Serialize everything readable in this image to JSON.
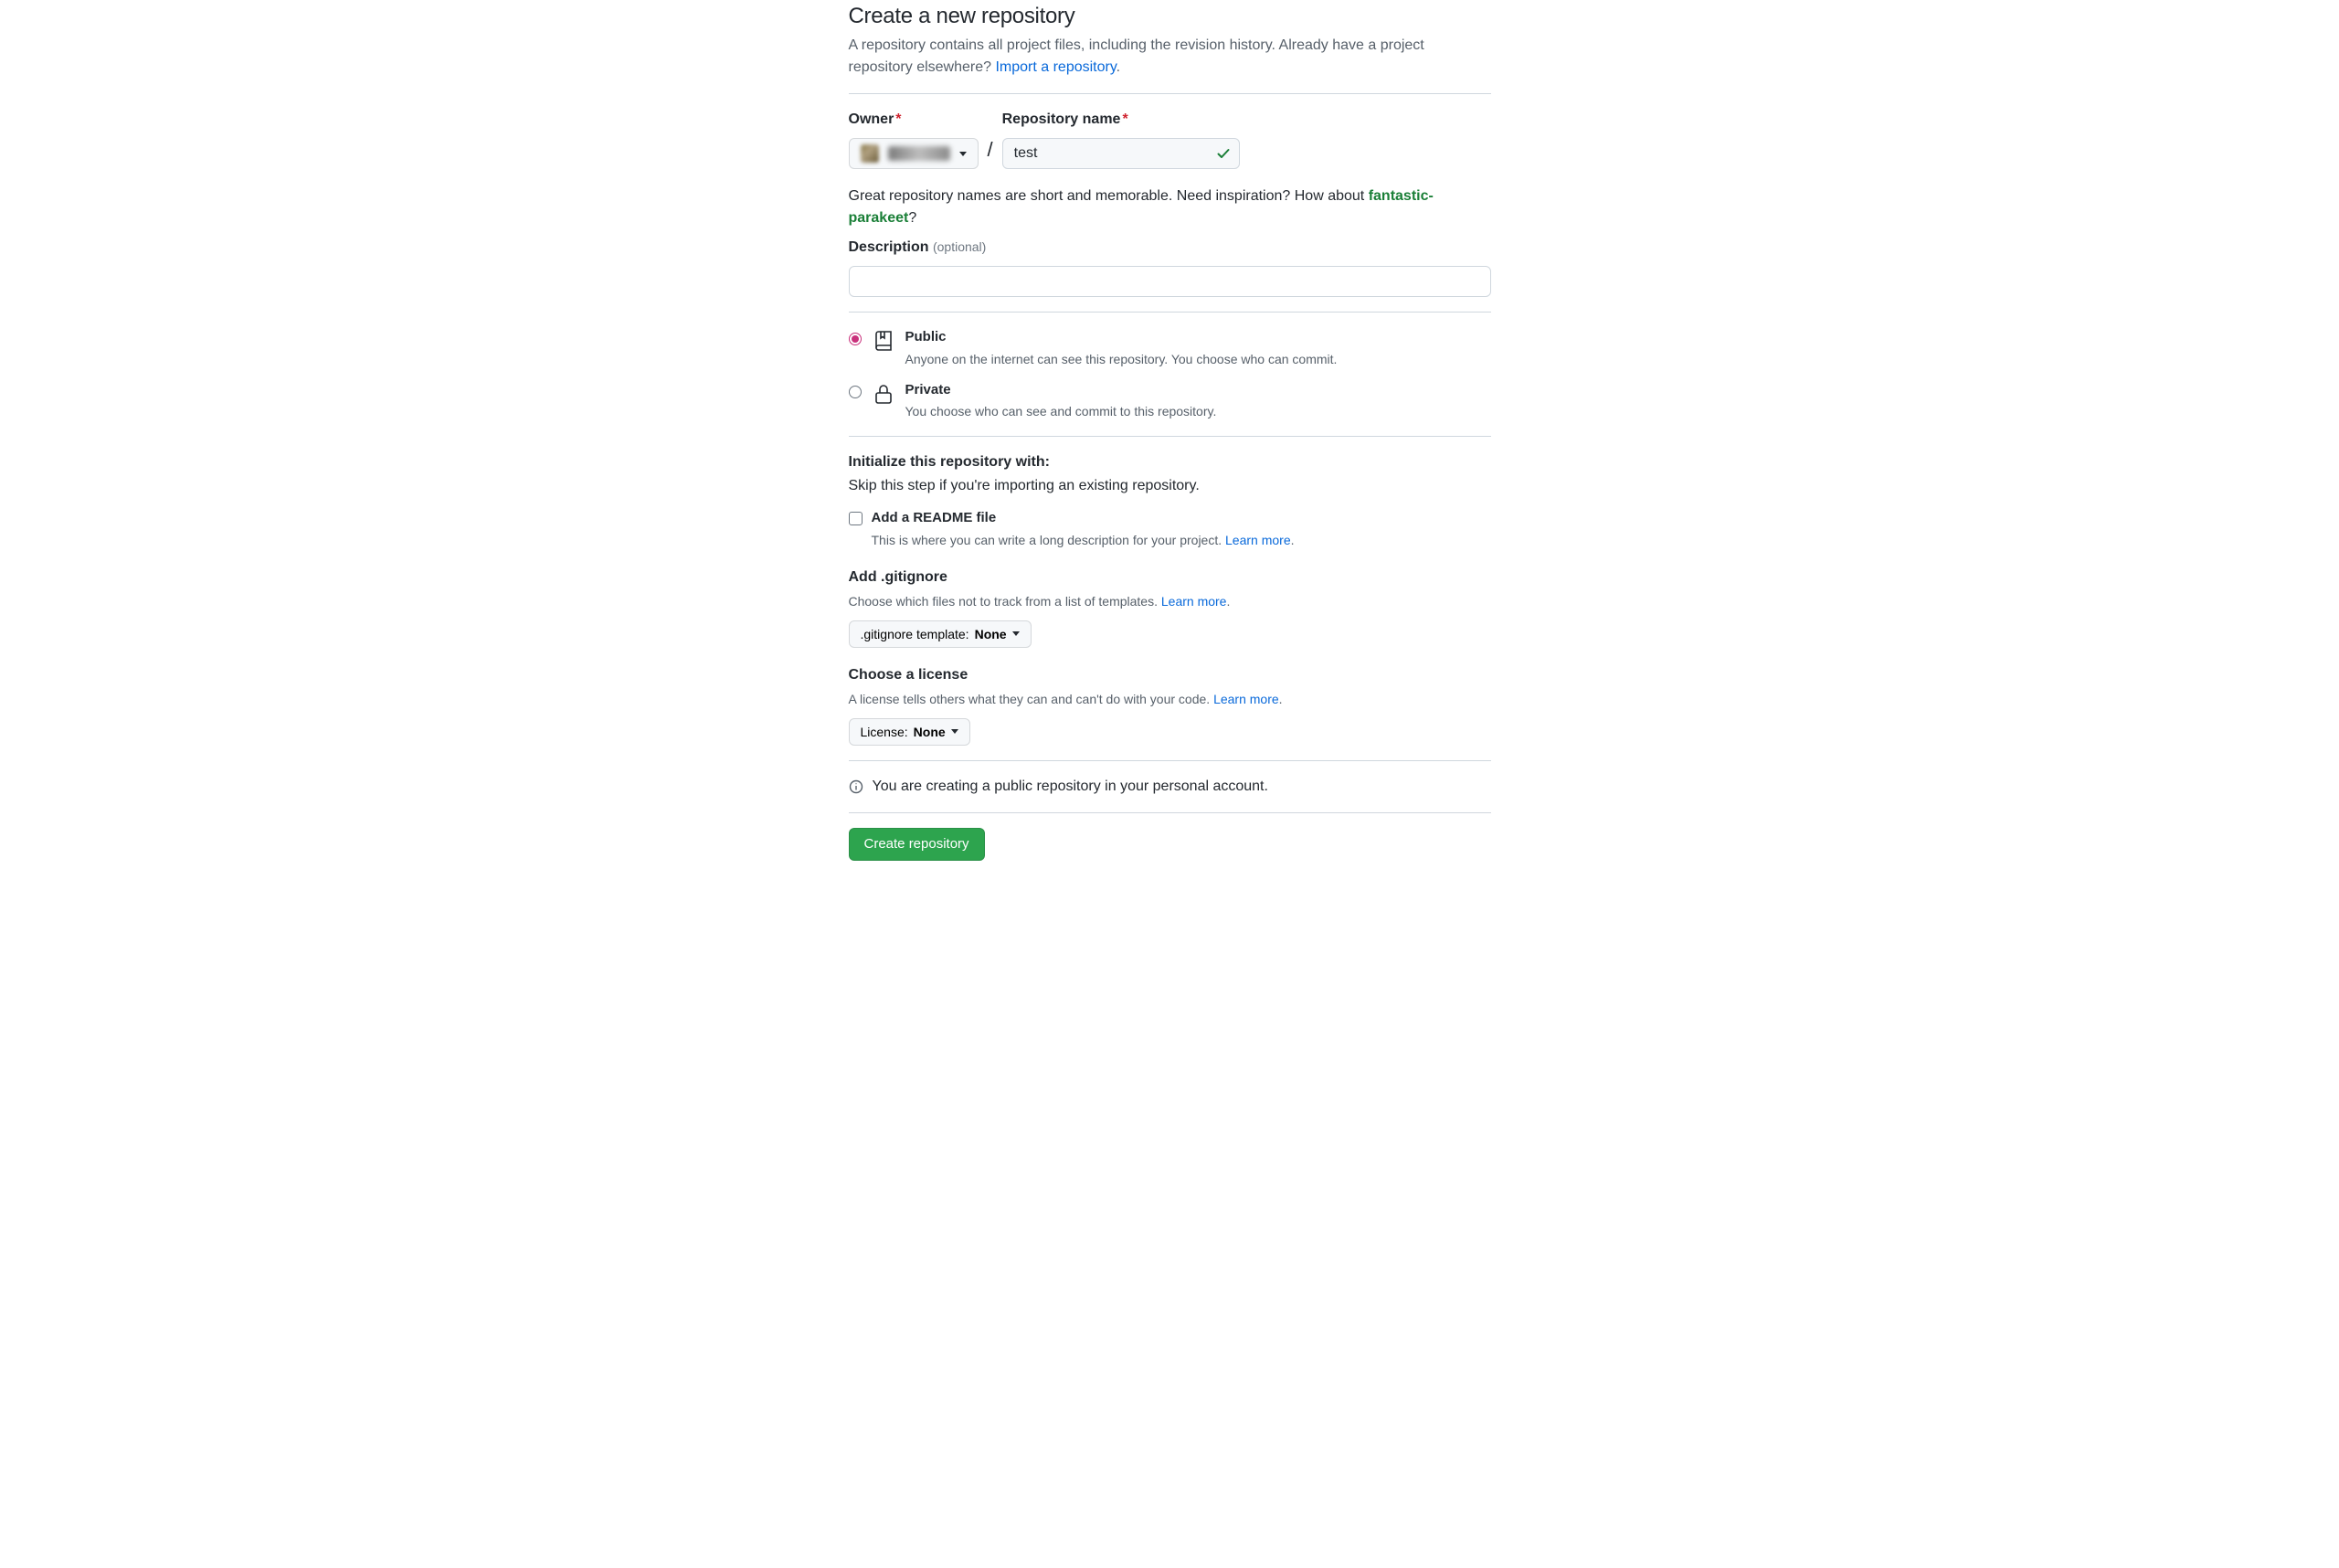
{
  "page": {
    "title": "Create a new repository",
    "subhead_prefix": "A repository contains all project files, including the revision history. Already have a project repository elsewhere? ",
    "import_link": "Import a repository"
  },
  "owner": {
    "label": "Owner"
  },
  "repo": {
    "label": "Repository name",
    "value": "test",
    "hint_prefix": "Great repository names are short and memorable. Need inspiration? How about ",
    "suggestion": "fantastic-parakeet",
    "hint_suffix": "?"
  },
  "description": {
    "label": "Description",
    "optional": "(optional)"
  },
  "visibility": {
    "public": {
      "title": "Public",
      "desc": "Anyone on the internet can see this repository. You choose who can commit."
    },
    "private": {
      "title": "Private",
      "desc": "You choose who can see and commit to this repository."
    }
  },
  "init": {
    "heading": "Initialize this repository with:",
    "skip_note": "Skip this step if you're importing an existing repository.",
    "readme": {
      "title": "Add a README file",
      "desc_prefix": "This is where you can write a long description for your project. ",
      "learn_more": "Learn more"
    },
    "gitignore": {
      "title": "Add .gitignore",
      "desc_prefix": "Choose which files not to track from a list of templates. ",
      "learn_more": "Learn more",
      "button_prefix": ".gitignore template: ",
      "button_value": "None"
    },
    "license": {
      "title": "Choose a license",
      "desc_prefix": "A license tells others what they can and can't do with your code. ",
      "learn_more": "Learn more",
      "button_prefix": "License: ",
      "button_value": "None"
    }
  },
  "info_note": "You are creating a public repository in your personal account.",
  "submit_label": "Create repository"
}
